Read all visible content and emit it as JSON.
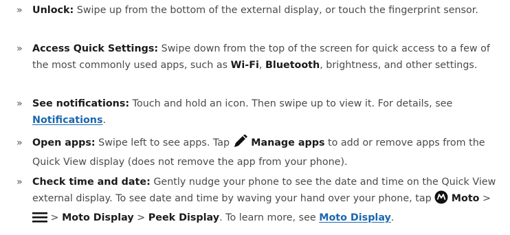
{
  "bullet": "»",
  "items": [
    {
      "title": "Unlock:",
      "text": " Swipe up from the bottom of the external display, or touch the fingerprint sensor."
    },
    {
      "title": "Access Quick Settings:",
      "text_a": " Swipe down from the top of the screen for quick access to a few of the most commonly used apps, such as ",
      "wifi": "Wi-Fi",
      "comma": ", ",
      "bluetooth": "Bluetooth",
      "text_b": ", brightness, and other settings."
    },
    {
      "title": "See notifications:",
      "text": " Touch and hold an icon. Then swipe up to view it. For details, see ",
      "link": "Notifications",
      "end": "."
    },
    {
      "title": "Open apps:",
      "text_a": " Swipe left to see apps. Tap ",
      "icon": "pencil-icon",
      "manage": "Manage apps",
      "text_b": " to add or remove apps from the Quick View display (does not remove the app from your phone)."
    },
    {
      "title": "Check time and date:",
      "text_a": " Gently nudge your phone to see the date and time on the Quick View external display. To see date and time by waving your hand over your phone, tap ",
      "moto_icon": "motorola-logo-icon",
      "moto": "Moto",
      "sep1": " > ",
      "menu_icon": "menu-icon",
      "sep2": " > ",
      "moto_display": "Moto Display",
      "sep3": " > ",
      "peek": "Peek Display",
      "text_b": ". To learn more, see ",
      "link": "Moto Display",
      "end": "."
    }
  ],
  "colors": {
    "text": "#4a4a4a",
    "bold": "#1b1b1b",
    "link": "#1a67b0"
  }
}
